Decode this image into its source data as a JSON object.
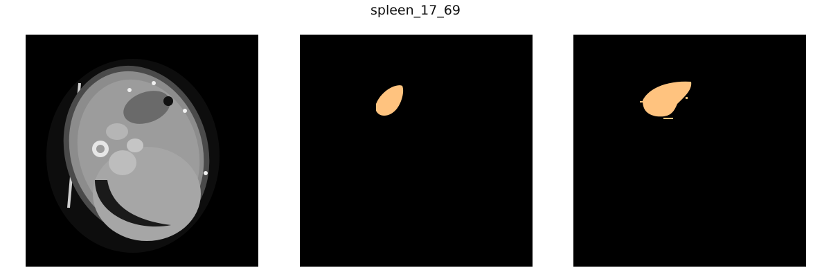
{
  "figure": {
    "title": "spleen_17_69"
  },
  "panels": [
    {
      "id": "ct",
      "kind": "ct-scan-image"
    },
    {
      "id": "gt",
      "kind": "segmentation-mask",
      "mask_color": "#ffc37f"
    },
    {
      "id": "pred",
      "kind": "segmentation-mask",
      "mask_color": "#ffc37f"
    }
  ]
}
